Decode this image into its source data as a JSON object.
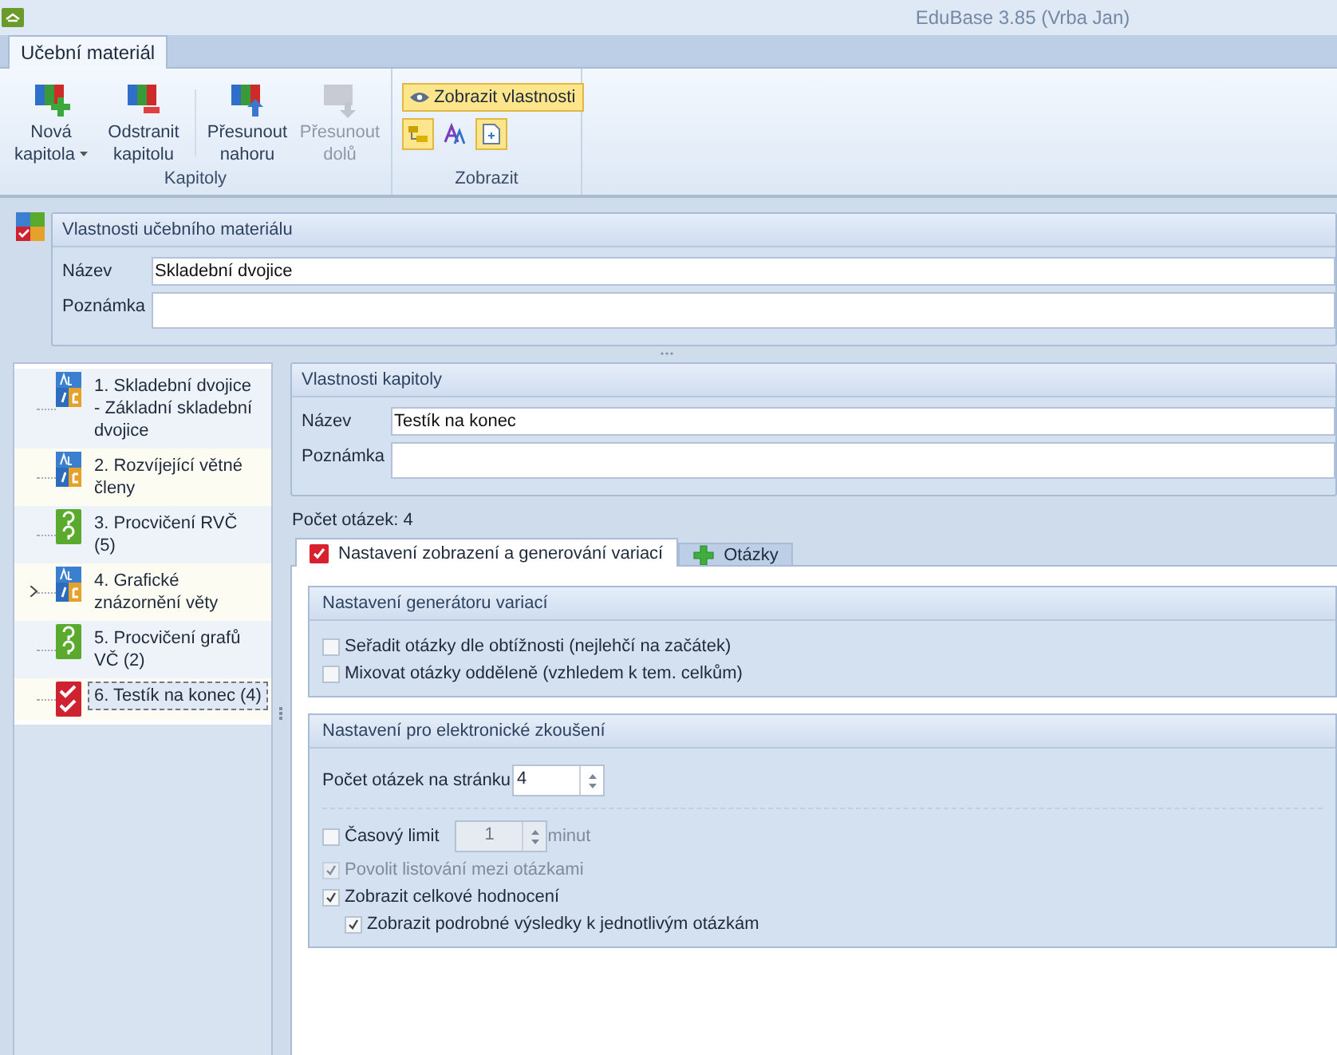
{
  "window": {
    "title": "EduBase 3.85 (Vrba Jan)"
  },
  "ribbon": {
    "tabs": [
      {
        "label": "Učební materiál",
        "selected": true
      }
    ],
    "groups": [
      {
        "label": "Kapitoly",
        "buttons": [
          {
            "kind": "add",
            "label": "Nová kapitola",
            "dropdown": true,
            "disabled": false
          },
          {
            "kind": "remove",
            "label": "Odstranit kapitolu",
            "dropdown": false,
            "disabled": false
          },
          {
            "kind": "up",
            "label": "Přesunout nahoru",
            "dropdown": false,
            "disabled": false
          },
          {
            "kind": "down",
            "label": "Přesunout dolů",
            "dropdown": false,
            "disabled": true
          }
        ]
      },
      {
        "label": "Zobrazit",
        "toggle": {
          "label": "Zobrazit vlastnosti",
          "selected": true
        },
        "small_buttons": [
          {
            "kind": "tree",
            "selected": true
          },
          {
            "kind": "font",
            "selected": false
          },
          {
            "kind": "page",
            "selected": true
          }
        ]
      }
    ]
  },
  "material": {
    "title": "Vlastnosti učebního materiálu",
    "fields": [
      {
        "label": "Název",
        "value": "Skladební dvojice"
      },
      {
        "label": "Poznámka"
      }
    ]
  },
  "chapters": [
    {
      "label": "1. Skladební dvojice - Základní skladební dvojice",
      "kind": "text",
      "has_children": false,
      "selected": false
    },
    {
      "label": "2. Rozvíjející větné členy",
      "kind": "text",
      "has_children": false,
      "selected": false
    },
    {
      "label": "3. Procvičení RVČ (5)",
      "kind": "exercise",
      "has_children": false,
      "selected": false
    },
    {
      "label": "4. Grafické znázornění věty",
      "kind": "text",
      "has_children": true,
      "selected": false
    },
    {
      "label": "5. Procvičení grafů VČ (2)",
      "kind": "exercise",
      "has_children": false,
      "selected": false
    },
    {
      "label": "6. Testík na konec (4)",
      "kind": "test",
      "has_children": false,
      "selected": true
    }
  ],
  "chapter": {
    "title": "Vlastnosti kapitoly",
    "fields": [
      {
        "label": "Název",
        "value": "Testík na konec"
      },
      {
        "label": "Poznámka"
      }
    ]
  },
  "question_count": "Počet otázek: 4",
  "tabs": [
    {
      "label": "Nastavení zobrazení a generování variací",
      "kind": "settings",
      "selected": true
    },
    {
      "label": "Otázky",
      "kind": "questions",
      "selected": false
    }
  ],
  "generator": {
    "title": "Nastavení generátoru variací",
    "options": [
      {
        "label": "Seřadit otázky dle obtížnosti (nejlehčí na začátek)",
        "checked": false,
        "disabled": false
      },
      {
        "label": "Mixovat otázky odděleně (vzhledem k tem. celkům)",
        "checked": false,
        "disabled": false
      }
    ]
  },
  "exam": {
    "title": "Nastavení pro elektronické zkoušení",
    "per_page": {
      "label": "Počet otázek na stránku",
      "value": "4",
      "disabled": false
    },
    "time_limit": {
      "label": "Časový limit",
      "checked": false,
      "disabled": false,
      "value": "1",
      "value_disabled": true,
      "unit": "minut"
    },
    "options": [
      {
        "label": "Povolit listování mezi otázkami",
        "checked": true,
        "disabled": true
      },
      {
        "label": "Zobrazit celkové hodnocení",
        "checked": true,
        "disabled": false,
        "children": [
          {
            "label": "Zobrazit podrobné výsledky k jednotlivým otázkám",
            "checked": true,
            "disabled": false
          }
        ]
      }
    ]
  }
}
